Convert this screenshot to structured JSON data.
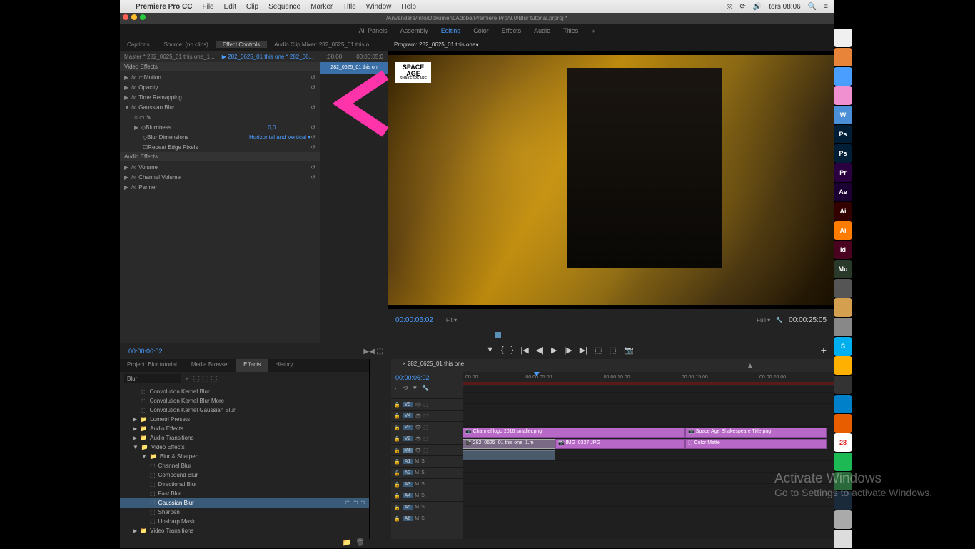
{
  "menubar": {
    "app": "Premiere Pro CC",
    "items": [
      "File",
      "Edit",
      "Clip",
      "Sequence",
      "Marker",
      "Title",
      "Window",
      "Help"
    ],
    "time": "tors 08:06"
  },
  "window_title": "/Användare/Info/Dokument/Adobe/Premiere Pro/9.0/Blur tutorial.prproj *",
  "workspaces": [
    "All Panels",
    "Assembly",
    "Editing",
    "Color",
    "Effects",
    "Audio",
    "Titles"
  ],
  "workspace_active": "Editing",
  "source_tabs": [
    "Captions",
    "Source: (no clips)",
    "Effect Controls",
    "Audio Clip Mixer: 282_0625_01 this o"
  ],
  "source_tab_active": "Effect Controls",
  "effect_controls": {
    "master": "Master * 282_0625_01 this one_1...",
    "clip": "282_0625_01 this one * 282_06...",
    "tc_right": "00:00:05:0",
    "tc_start": ":00:00",
    "strip_label": "282_0625_01 this on",
    "video_effects": "Video Effects",
    "motion": "Motion",
    "opacity": "Opacity",
    "time_remap": "Time Remapping",
    "gaussian": "Gaussian Blur",
    "blurriness": "Blurriness",
    "blurriness_val": "0,0",
    "blur_dim": "Blur Dimensions",
    "blur_dim_val": "Horizontal and Vertical",
    "repeat_edge": "Repeat Edge Pixels",
    "audio_effects": "Audio Effects",
    "volume": "Volume",
    "channel_vol": "Channel Volume",
    "panner": "Panner",
    "timecode": "00:00:06:02"
  },
  "program_tab": "Program: 282_0625_01 this one",
  "space_age": {
    "line1": "SPACE",
    "line2": "AGE",
    "sub": "SHAKESPEARE"
  },
  "transport": {
    "tc": "00:00:06:02",
    "fit": "Fit",
    "full": "Full",
    "duration": "00:00:25:05"
  },
  "project_tabs": [
    "Project: Blur tutorial",
    "Media Browser",
    "Effects",
    "History"
  ],
  "project_tab_active": "Effects",
  "search_value": "Blur",
  "effects_tree": {
    "top": [
      "Convolution Kernel Blur",
      "Convolution Kernel Blur More",
      "Convolution Kernel Gaussian Blur"
    ],
    "folders": [
      "Lumetri Presets",
      "Audio Effects",
      "Audio Transitions",
      "Video Effects"
    ],
    "blur_sharpen": "Blur & Sharpen",
    "blur_items": [
      "Channel Blur",
      "Compound Blur",
      "Directional Blur",
      "Fast Blur",
      "Gaussian Blur",
      "Sharpen",
      "Unsharp Mask"
    ],
    "video_trans": "Video Transitions"
  },
  "timeline": {
    "seq_name": "282_0625_01 this one",
    "tc": "00:00:06:02",
    "ruler": [
      ":00:00",
      "00:00:05:00",
      "00:00:10:00",
      "00:00:15:00",
      "00:00:20:00"
    ],
    "video_tracks": [
      "V5",
      "V4",
      "V3",
      "V2",
      "V1"
    ],
    "audio_tracks": [
      "A1",
      "A2",
      "A3",
      "A4",
      "A5",
      "A6"
    ],
    "clips": {
      "v2": "Channel logo 2016 smaller.png",
      "v2b": "Space Age Shakespeare Title.png",
      "v1a": "282_0625_01 this one_1.m",
      "v1b": "IMG_0327.JPG",
      "v1c": "Color Matte"
    }
  },
  "watermark": {
    "t1": "Activate Windows",
    "t2": "Go to Settings to activate Windows."
  },
  "dock": [
    {
      "bg": "#f0f0f0",
      "t": ""
    },
    {
      "bg": "#e8833a",
      "t": ""
    },
    {
      "bg": "#4a9eff",
      "t": ""
    },
    {
      "bg": "#f090d0",
      "t": ""
    },
    {
      "bg": "#4a8fd8",
      "t": "W"
    },
    {
      "bg": "#001e36",
      "t": "Ps"
    },
    {
      "bg": "#001e36",
      "t": "Ps"
    },
    {
      "bg": "#2a0040",
      "t": "Pr"
    },
    {
      "bg": "#1a0033",
      "t": "Ae"
    },
    {
      "bg": "#330000",
      "t": "Ai"
    },
    {
      "bg": "#ff7c00",
      "t": "Ai"
    },
    {
      "bg": "#49021f",
      "t": "Id"
    },
    {
      "bg": "#2a3a2a",
      "t": "Mu"
    },
    {
      "bg": "#555",
      "t": ""
    },
    {
      "bg": "#d4a050",
      "t": ""
    },
    {
      "bg": "#888",
      "t": ""
    },
    {
      "bg": "#00aff0",
      "t": "S"
    },
    {
      "bg": "#ffb000",
      "t": ""
    },
    {
      "bg": "#333",
      "t": ""
    },
    {
      "bg": "#0080c8",
      "t": ""
    },
    {
      "bg": "#e85d00",
      "t": ""
    },
    {
      "bg": "#fff",
      "t": "28"
    },
    {
      "bg": "#1db954",
      "t": ""
    },
    {
      "bg": "#2a6a3a",
      "t": ""
    },
    {
      "bg": "#1a2a3a",
      "t": ""
    },
    {
      "bg": "#aaa",
      "t": ""
    },
    {
      "bg": "#ddd",
      "t": ""
    }
  ]
}
